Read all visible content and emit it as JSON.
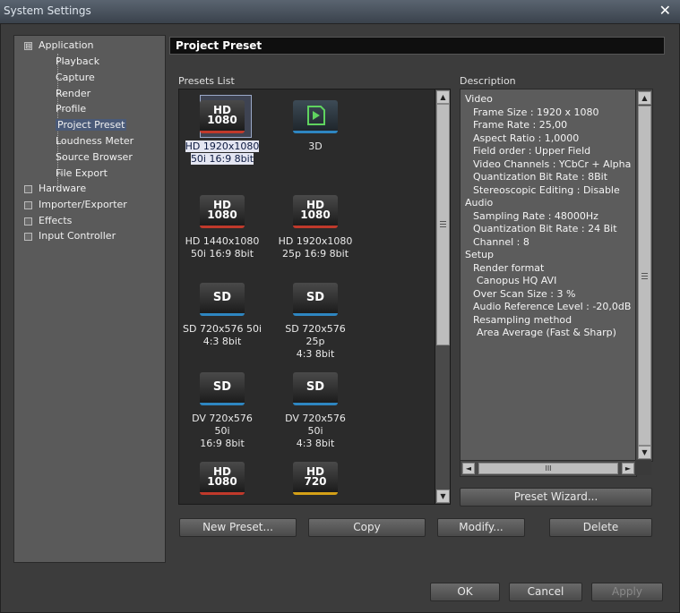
{
  "window": {
    "title": "System Settings",
    "close_glyph": "✕"
  },
  "tree": {
    "application": {
      "label": "Application",
      "expander": "⊟"
    },
    "app_children": [
      "Playback",
      "Capture",
      "Render",
      "Profile",
      "Project Preset",
      "Loudness Meter",
      "Source Browser",
      "File Export"
    ],
    "selected": "Project Preset",
    "roots": [
      {
        "label": "Hardware",
        "expander": "⊞"
      },
      {
        "label": "Importer/Exporter",
        "expander": "⊞"
      },
      {
        "label": "Effects",
        "expander": "⊞"
      },
      {
        "label": "Input Controller",
        "expander": "⊞"
      }
    ]
  },
  "panel": {
    "title": "Project Preset",
    "presets_label": "Presets List",
    "description_label": "Description"
  },
  "presets": [
    {
      "icon": "hd-1080-icon",
      "top": "HD",
      "bottom": "1080",
      "line1": "HD 1920x1080",
      "line2": "50i 16:9 8bit",
      "selected": true
    },
    {
      "icon": "3d-icon",
      "top": "",
      "bottom": "",
      "line1": "3D",
      "line2": ""
    },
    {
      "icon": "hd-1080-icon",
      "top": "HD",
      "bottom": "1080",
      "line1": "HD 1440x1080",
      "line2": "50i 16:9 8bit"
    },
    {
      "icon": "hd-1080-icon",
      "top": "HD",
      "bottom": "1080",
      "line1": "HD 1920x1080",
      "line2": "25p 16:9 8bit"
    },
    {
      "icon": "sd-icon",
      "top": "SD",
      "bottom": "",
      "line1": "SD 720x576 50i",
      "line2": "4:3 8bit"
    },
    {
      "icon": "sd-icon",
      "top": "SD",
      "bottom": "",
      "line1": "SD 720x576 25p",
      "line2": "4:3 8bit"
    },
    {
      "icon": "sd-icon",
      "top": "SD",
      "bottom": "",
      "line1": "DV 720x576 50i",
      "line2": "16:9 8bit"
    },
    {
      "icon": "sd-icon",
      "top": "SD",
      "bottom": "",
      "line1": "DV 720x576 50i",
      "line2": "4:3 8bit"
    },
    {
      "icon": "hd-1080-icon",
      "top": "HD",
      "bottom": "1080",
      "line1": "",
      "line2": ""
    },
    {
      "icon": "hd-720-icon",
      "top": "HD",
      "bottom": "720",
      "line1": "",
      "line2": ""
    }
  ],
  "description": [
    {
      "indent": 0,
      "text": "Video"
    },
    {
      "indent": 1,
      "text": "Frame Size : 1920 x 1080"
    },
    {
      "indent": 1,
      "text": "Frame Rate : 25,00"
    },
    {
      "indent": 1,
      "text": "Aspect Ratio : 1,0000"
    },
    {
      "indent": 1,
      "text": "Field order : Upper Field"
    },
    {
      "indent": 1,
      "text": "Video Channels : YCbCr + Alpha"
    },
    {
      "indent": 1,
      "text": "Quantization Bit Rate : 8Bit"
    },
    {
      "indent": 1,
      "text": "Stereoscopic Editing : Disable"
    },
    {
      "indent": 0,
      "text": "Audio"
    },
    {
      "indent": 1,
      "text": "Sampling Rate : 48000Hz"
    },
    {
      "indent": 1,
      "text": "Quantization Bit Rate : 24 Bit"
    },
    {
      "indent": 1,
      "text": "Channel : 8"
    },
    {
      "indent": 0,
      "text": "Setup"
    },
    {
      "indent": 1,
      "text": "Render format"
    },
    {
      "indent": 2,
      "text": "Canopus HQ AVI"
    },
    {
      "indent": 1,
      "text": "Over Scan Size : 3 %"
    },
    {
      "indent": 1,
      "text": "Audio Reference Level : -20,0dB"
    },
    {
      "indent": 1,
      "text": "Resampling method"
    },
    {
      "indent": 2,
      "text": "Area Average (Fast & Sharp)"
    }
  ],
  "buttons": {
    "preset_wizard": "Preset Wizard...",
    "new_preset": "New Preset...",
    "copy": "Copy",
    "modify": "Modify...",
    "delete": "Delete",
    "ok": "OK",
    "cancel": "Cancel",
    "apply": "Apply"
  },
  "glyphs": {
    "up": "▲",
    "down": "▼",
    "left": "◄",
    "right": "►",
    "grip": "III"
  },
  "colors": {
    "hd_accent": "#c0392b",
    "sd_accent": "#2e86c1",
    "hd720_accent": "#d4a017",
    "selection": "#4a5a78"
  }
}
